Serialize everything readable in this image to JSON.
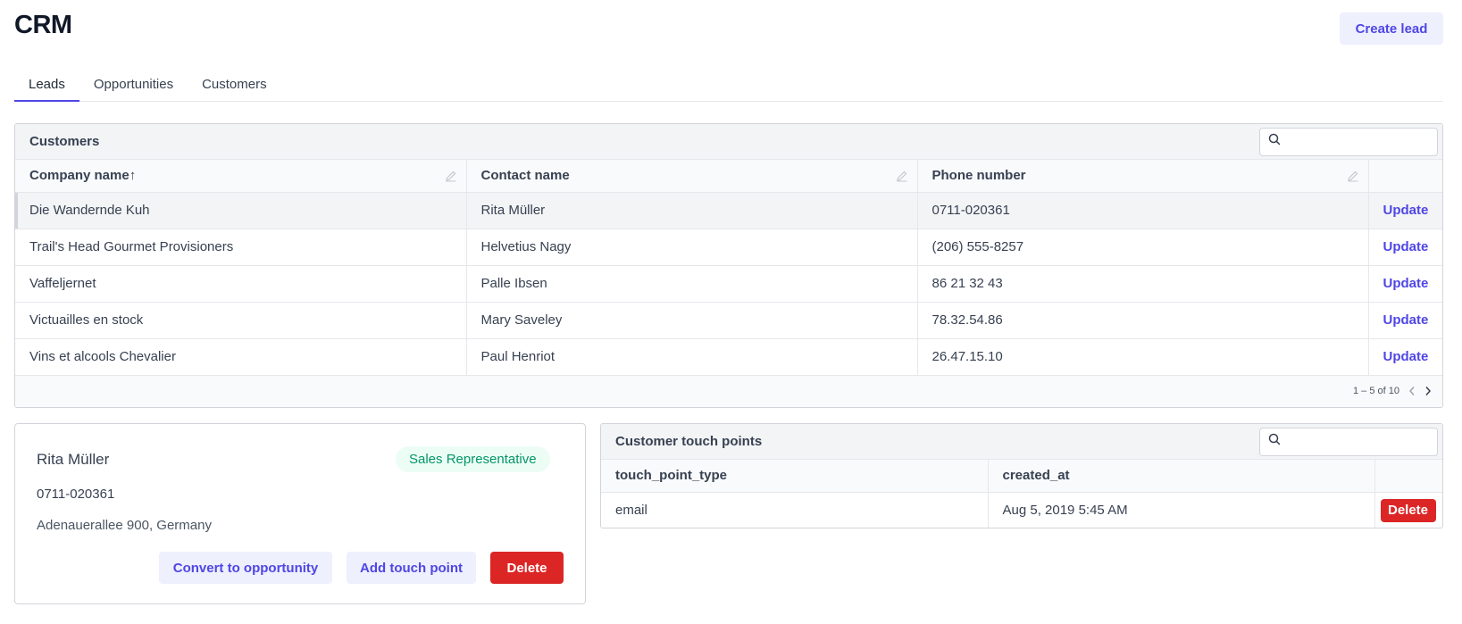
{
  "app": {
    "title": "CRM",
    "create_label": "Create lead"
  },
  "tabs": [
    {
      "label": "Leads",
      "active": true
    },
    {
      "label": "Opportunities",
      "active": false
    },
    {
      "label": "Customers",
      "active": false
    }
  ],
  "customers": {
    "title": "Customers",
    "search_placeholder": "",
    "columns": [
      "Company name",
      "Contact name",
      "Phone number",
      ""
    ],
    "sort_indicator": "↑",
    "action_label": "Update",
    "rows": [
      {
        "company": "Die Wandernde Kuh",
        "contact": "Rita Müller",
        "phone": "0711-020361",
        "selected": true
      },
      {
        "company": "Trail's Head Gourmet Provisioners",
        "contact": "Helvetius Nagy",
        "phone": "(206) 555-8257"
      },
      {
        "company": "Vaffeljernet",
        "contact": "Palle Ibsen",
        "phone": "86 21 32 43"
      },
      {
        "company": "Victuailles en stock",
        "contact": "Mary Saveley",
        "phone": "78.32.54.86"
      },
      {
        "company": "Vins et alcools Chevalier",
        "contact": "Paul Henriot",
        "phone": "26.47.15.10"
      }
    ],
    "pagination": "1 – 5 of 10"
  },
  "detail": {
    "name": "Rita Müller",
    "role": "Sales Representative",
    "phone": "0711-020361",
    "address": "Adenauerallee 900, Germany",
    "convert_label": "Convert to opportunity",
    "add_touch_label": "Add touch point",
    "delete_label": "Delete"
  },
  "touch_points": {
    "title": "Customer touch points",
    "search_placeholder": "",
    "columns": [
      "touch_point_type",
      "created_at",
      ""
    ],
    "rows": [
      {
        "type": "email",
        "created_at": "Aug 5, 2019 5:45 AM",
        "action": "Delete"
      }
    ]
  },
  "colors": {
    "accent": "#4f46e5",
    "danger": "#dc2626",
    "success": "#059669"
  }
}
